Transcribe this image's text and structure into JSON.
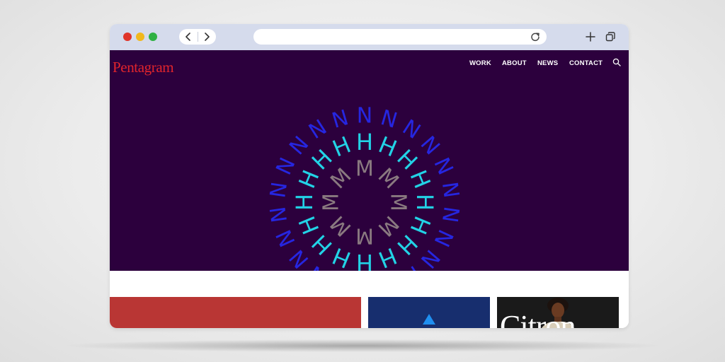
{
  "browser": {
    "url": "",
    "icons": {
      "back": "chevron-left-icon",
      "forward": "chevron-right-icon",
      "reload": "reload-icon",
      "new_tab": "plus-icon",
      "tabs": "tabs-icon"
    },
    "traffic_colors": [
      "#e0352b",
      "#f1b81d",
      "#2fb143"
    ]
  },
  "site": {
    "logo": "Pentagram",
    "nav": [
      "WORK",
      "ABOUT",
      "NEWS",
      "CONTACT"
    ],
    "search_icon": "search-icon",
    "colors": {
      "hero_bg": "#2c003d",
      "logo": "#e0242c",
      "ring_outer": "#2626e0",
      "ring_middle": "#22d3e6",
      "ring_inner": "#8a7a80"
    },
    "emblem": {
      "rings": [
        {
          "letter": "N",
          "count": 22
        },
        {
          "letter": "H",
          "count": 16
        },
        {
          "letter": "M",
          "count": 8
        }
      ]
    },
    "tiles": [
      {
        "color": "#b93634",
        "text": ""
      },
      {
        "color": "#172e6e",
        "text": ""
      },
      {
        "color": "#1a1a1a",
        "text": "Citron"
      }
    ]
  }
}
